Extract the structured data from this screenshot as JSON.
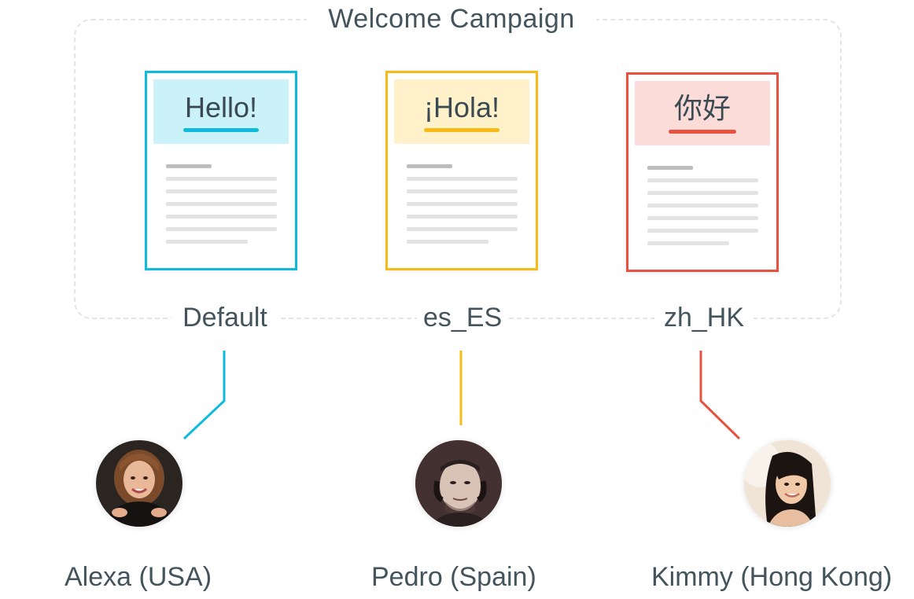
{
  "campaign": {
    "title": "Welcome Campaign"
  },
  "variants": [
    {
      "locale": "Default",
      "greeting": "Hello!",
      "accent": "#0ebbdc",
      "header_bg": "#cbf1f9"
    },
    {
      "locale": "es_ES",
      "greeting": "¡Hola!",
      "accent": "#f6bb17",
      "header_bg": "#fff1ca"
    },
    {
      "locale": "zh_HK",
      "greeting": "你好",
      "accent": "#e7533f",
      "header_bg": "#fbdcd8"
    }
  ],
  "users": [
    {
      "name": "Alexa (USA)",
      "avatar_icon": "person-photo-icon"
    },
    {
      "name": "Pedro (Spain)",
      "avatar_icon": "person-photo-icon"
    },
    {
      "name": "Kimmy (Hong Kong)",
      "avatar_icon": "person-photo-icon"
    }
  ]
}
